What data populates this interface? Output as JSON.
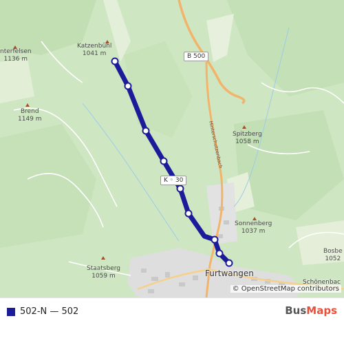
{
  "map": {
    "peaks": [
      {
        "name": "Katzenbühl",
        "elevation": "1041 m"
      },
      {
        "name": "nterfelsen",
        "elevation": "1136 m"
      },
      {
        "name": "Brend",
        "elevation": "1149 m"
      },
      {
        "name": "Spitzberg",
        "elevation": "1058 m"
      },
      {
        "name": "Sonnenberg",
        "elevation": "1037 m"
      },
      {
        "name": "Staatsberg",
        "elevation": "1059 m"
      },
      {
        "name": "Bosbe",
        "elevation": "1052"
      }
    ],
    "towns": [
      "Furtwangen",
      "Schönenbac"
    ],
    "road_shields": [
      "B 500",
      "K ◦ 30"
    ],
    "road_labels": [
      "Hinterschutzenbach"
    ],
    "route": {
      "color": "#1c1c9a",
      "stop_count": 9
    },
    "attribution": "© OpenStreetMap contributors"
  },
  "legend": {
    "label": "502-N — 502",
    "color": "#1c1c9a"
  },
  "brand": {
    "part1": "Bus",
    "part2": "Maps"
  }
}
